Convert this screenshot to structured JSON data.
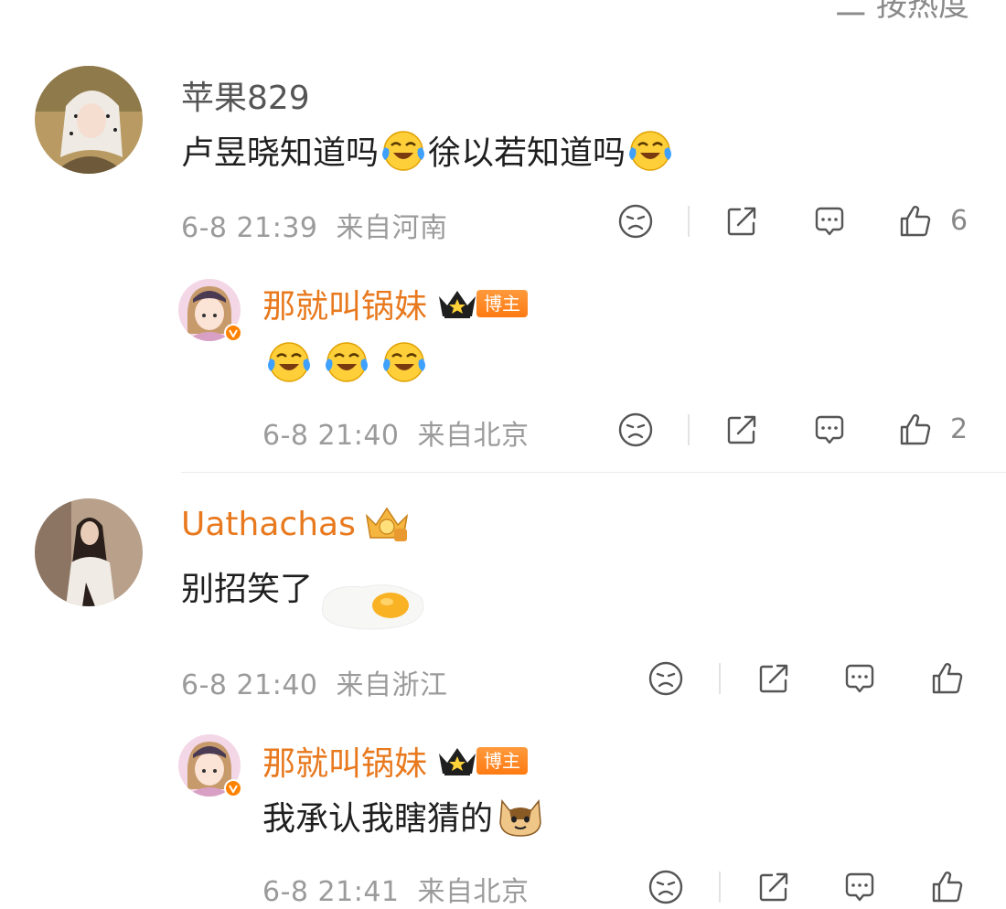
{
  "sort_label": "二 按热度",
  "comments": [
    {
      "username": "苹果829",
      "text_parts": [
        "卢昱晓知道吗",
        "徐以若知道吗"
      ],
      "time": "6-8 21:39",
      "location": "来自河南",
      "likes": "6",
      "reply": {
        "username": "那就叫锅妹",
        "badge": "博主",
        "time": "6-8 21:40",
        "location": "来自北京",
        "likes": "2"
      }
    },
    {
      "username": "Uathachas",
      "text": "别招笑了",
      "time": "6-8 21:40",
      "location": "来自浙江",
      "likes": "",
      "reply": {
        "username": "那就叫锅妹",
        "badge": "博主",
        "text": "我承认我瞎猜的",
        "time": "6-8 21:41",
        "location": "来自北京",
        "likes": ""
      }
    }
  ],
  "colors": {
    "accent_orange": "#ff8200",
    "username_orange": "#e8791e",
    "meta_gray": "#9b9b9b"
  }
}
